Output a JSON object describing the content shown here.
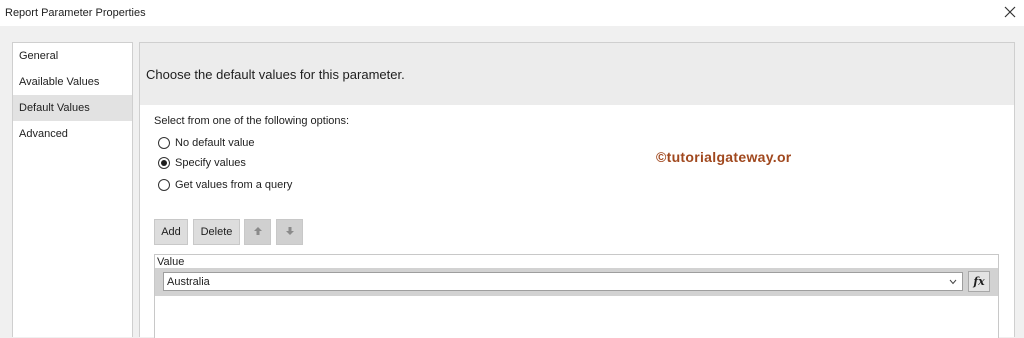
{
  "window": {
    "title": "Report Parameter Properties",
    "close_icon": "close-icon"
  },
  "nav": {
    "items": [
      {
        "label": "General",
        "selected": false
      },
      {
        "label": "Available Values",
        "selected": false
      },
      {
        "label": "Default Values",
        "selected": true
      },
      {
        "label": "Advanced",
        "selected": false
      }
    ]
  },
  "main": {
    "heading": "Choose the default values for this parameter.",
    "instructions": "Select from one of the following options:",
    "options": [
      {
        "label": "No default value",
        "checked": false
      },
      {
        "label": "Specify values",
        "checked": true
      },
      {
        "label": "Get values from a query",
        "checked": false
      }
    ],
    "watermark": "©tutorialgateway.or",
    "toolbar": {
      "add_label": "Add",
      "delete_label": "Delete",
      "move_up_icon": "move-up-icon",
      "move_down_icon": "move-down-icon"
    },
    "grid": {
      "column_header": "Value",
      "rows": [
        {
          "value": "Australia"
        }
      ],
      "expression_button": "fx"
    }
  },
  "colors": {
    "window_bg": "#f0f0f0",
    "header_band": "#ececec",
    "selected_nav": "#e2e2e2",
    "watermark": "#a0481e"
  }
}
